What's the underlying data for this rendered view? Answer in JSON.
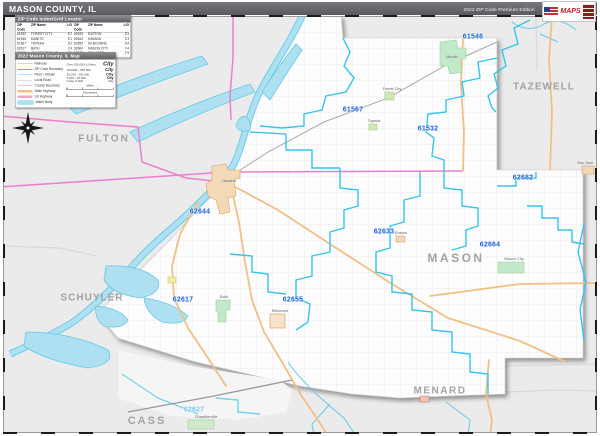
{
  "header": {
    "title": "MASON COUNTY, IL",
    "edition": "2022 ZIP Code Premium Edition",
    "logo_text": "MAPS"
  },
  "legend": {
    "index_title": "ZIP Code Index/Grid Locator",
    "columns": [
      "ZIP Code",
      "ZIP Name",
      "L/G"
    ],
    "rows_left": [
      {
        "zip": "61532",
        "name": "FOREST CITY",
        "lg": "E2"
      },
      {
        "zip": "61546",
        "name": "MANITO",
        "lg": "E1"
      },
      {
        "zip": "61567",
        "name": "TOPEKA",
        "lg": "D2"
      },
      {
        "zip": "62617",
        "name": "BATH",
        "lg": "C4"
      },
      {
        "zip": "62627",
        "name": "CHANDLERVILLE",
        "lg": "C6"
      }
    ],
    "rows_right": [
      {
        "zip": "62633",
        "name": "EASTON",
        "lg": "D3"
      },
      {
        "zip": "62644",
        "name": "HAVANA",
        "lg": "C3"
      },
      {
        "zip": "62655",
        "name": "KILBOURNE",
        "lg": "D4"
      },
      {
        "zip": "62664",
        "name": "MASON CITY",
        "lg": "F4"
      },
      {
        "zip": "62682",
        "name": "SAN JOSE",
        "lg": "F3"
      }
    ],
    "map_title": "2022 Mason County, IL Map",
    "line_items": [
      {
        "label": "Railroad"
      },
      {
        "label": "ZIP Code Boundary"
      },
      {
        "label": "River / Stream"
      },
      {
        "label": "Local Road"
      },
      {
        "label": "County Boundary"
      },
      {
        "label": "State Highway"
      },
      {
        "label": "US Highway"
      },
      {
        "label": "Water Body"
      }
    ],
    "city_rows": [
      {
        "range": "Over 250,000 & Metro",
        "sample": "City"
      },
      {
        "range": "100,000 - 250,000",
        "sample": "City"
      },
      {
        "range": "25,000 - 100,000",
        "sample": "City"
      },
      {
        "range": "5,000 - 25,000",
        "sample": "City"
      },
      {
        "range": "Under 5,000",
        "sample": "City"
      }
    ],
    "scale_labels": [
      "Miles",
      "Kilometers"
    ]
  },
  "map": {
    "zip_labels": [
      {
        "code": "61546"
      },
      {
        "code": "61567"
      },
      {
        "code": "61532"
      },
      {
        "code": "62682"
      },
      {
        "code": "62644"
      },
      {
        "code": "62633"
      },
      {
        "code": "62664"
      },
      {
        "code": "62617"
      },
      {
        "code": "62655"
      },
      {
        "code": "62627"
      }
    ],
    "county_labels": [
      {
        "name": "FULTON"
      },
      {
        "name": "TAZEWELL"
      },
      {
        "name": "SCHUYLER"
      },
      {
        "name": "MASON"
      },
      {
        "name": "MENARD"
      },
      {
        "name": "CASS"
      }
    ],
    "towns": [
      {
        "name": "Havana"
      },
      {
        "name": "Manito"
      },
      {
        "name": "Forest City"
      },
      {
        "name": "Topeka"
      },
      {
        "name": "Bath"
      },
      {
        "name": "Kilbourne"
      },
      {
        "name": "Mason City"
      },
      {
        "name": "Easton"
      },
      {
        "name": "San Jose"
      },
      {
        "name": "Chandlerville"
      }
    ]
  },
  "colors": {
    "header_bg": "#646468",
    "outside_county": "#ebebeb",
    "inside_county": "#fdfdfe",
    "water_fill": "#aee0f2",
    "water_stroke": "#62cbe9",
    "zip_boundary": "#35c5ea",
    "county_boundary": "#ee7ecd",
    "highway": "#f2bf85",
    "zip_label": "#1b62d6",
    "zip_label_outside": "#74c6ec",
    "county_label": "#a3a3a3",
    "urban_green": "#c2e9c9",
    "urban_tan": "#f3d9b6"
  }
}
